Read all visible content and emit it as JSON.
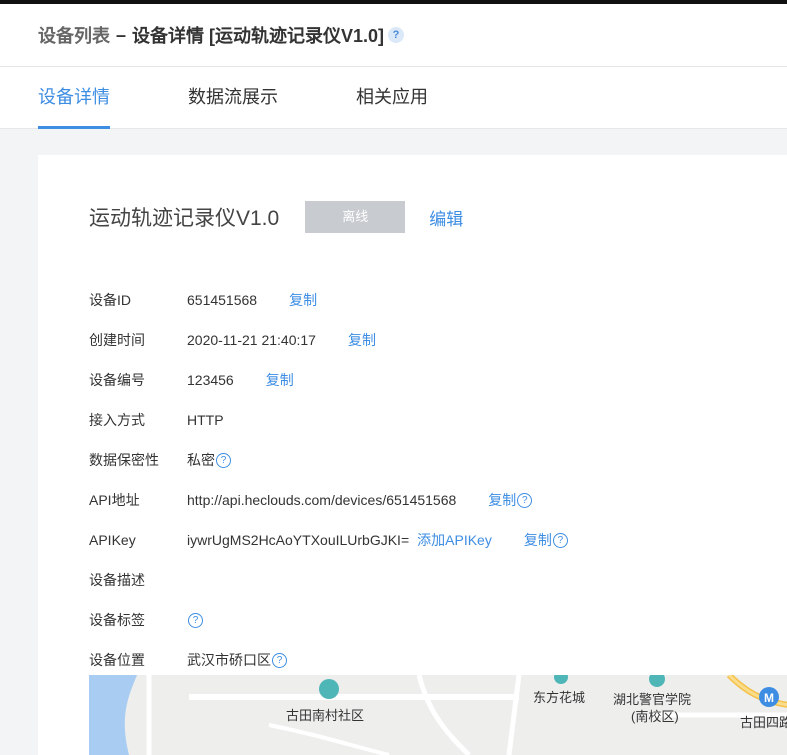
{
  "header": {
    "crumb_root": "设备列表",
    "separator": "–",
    "crumb_current": "设备详情 [运动轨迹记录仪V1.0]",
    "help": "?"
  },
  "tabs": [
    {
      "label": "设备详情"
    },
    {
      "label": "数据流展示"
    },
    {
      "label": "相关应用"
    }
  ],
  "device": {
    "title": "运动轨迹记录仪V1.0",
    "status": "离线",
    "edit_label": "编辑"
  },
  "fields": {
    "device_id": {
      "label": "设备ID",
      "value": "651451568",
      "action": "复制"
    },
    "created": {
      "label": "创建时间",
      "value": "2020-11-21 21:40:17",
      "action": "复制"
    },
    "serial": {
      "label": "设备编号",
      "value": "123456",
      "action": "复制"
    },
    "access": {
      "label": "接入方式",
      "value": "HTTP"
    },
    "privacy": {
      "label": "数据保密性",
      "value": "私密"
    },
    "api_addr": {
      "label": "API地址",
      "value": "http://api.heclouds.com/devices/651451568",
      "action": "复制"
    },
    "apikey": {
      "label": "APIKey",
      "value": "iywrUgMS2HcAoYTXouILUrbGJKI=",
      "add_action": "添加APIKey",
      "action": "复制"
    },
    "desc": {
      "label": "设备描述",
      "value": ""
    },
    "tags": {
      "label": "设备标签"
    },
    "location": {
      "label": "设备位置",
      "value": "武汉市硚口区"
    }
  },
  "map": {
    "labels": {
      "l1": "古田南村社区",
      "l2": "东方花城",
      "l3": "湖北警官学院",
      "l4": "(南校区)",
      "l5": "古田四路"
    }
  },
  "qmark": "?"
}
